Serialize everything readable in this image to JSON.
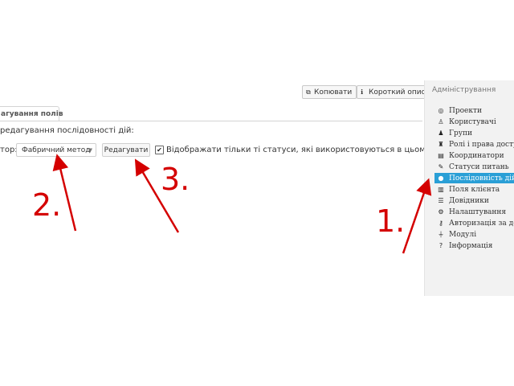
{
  "toolbar": {
    "copy_label": "Копювати",
    "short_desc_label": "Короткий опис",
    "copy_icon": "copy-icon",
    "desc_icon": "info-icon"
  },
  "tabs": [
    {
      "label": "агування полів"
    }
  ],
  "main": {
    "heading": "редагування послідовності дій:",
    "field_label": "тор:",
    "select_value": "Фабричний метод",
    "edit_button": "Редагувати",
    "checkbox_checked": true,
    "checkbox_label": "Відображати тільки ті статуси, які використовуються в цьому"
  },
  "sidebar": {
    "title": "Адміністрування",
    "active_color": "#2a9fd6",
    "items": [
      {
        "label": "Проекти",
        "icon": "target-icon",
        "glyph": "◎"
      },
      {
        "label": "Користувачі",
        "icon": "user-icon",
        "glyph": "👤"
      },
      {
        "label": "Групи",
        "icon": "users-icon",
        "glyph": "👥"
      },
      {
        "label": "Ролі і права доступу",
        "icon": "user-lock-icon",
        "glyph": "🔒"
      },
      {
        "label": "Координатори",
        "icon": "file-icon",
        "glyph": "▤"
      },
      {
        "label": "Статуси питань",
        "icon": "edit-icon",
        "glyph": "✎"
      },
      {
        "label": "Послідовність дій",
        "icon": "tint-icon",
        "glyph": "💧",
        "active": true
      },
      {
        "label": "Поля клієнта",
        "icon": "columns-icon",
        "glyph": "▥"
      },
      {
        "label": "Довідники",
        "icon": "list-icon",
        "glyph": "☰"
      },
      {
        "label": "Налаштування",
        "icon": "cog-icon",
        "glyph": "⚙"
      },
      {
        "label": "Авторизація за допо",
        "icon": "key-icon",
        "glyph": "⚷"
      },
      {
        "label": "Модулі",
        "icon": "plug-icon",
        "glyph": "⏚"
      },
      {
        "label": "Інформація",
        "icon": "question-icon",
        "glyph": "?"
      }
    ]
  },
  "annotations": {
    "color": "#d40000",
    "labels": [
      "1.",
      "2.",
      "3."
    ]
  }
}
